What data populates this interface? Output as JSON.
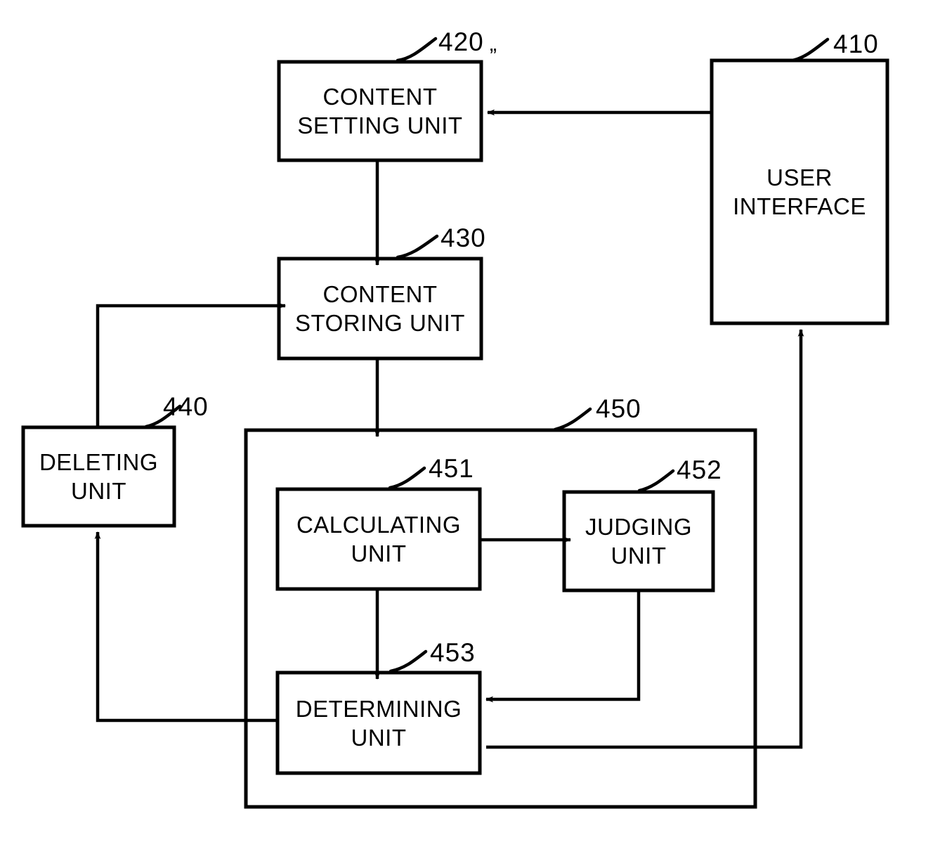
{
  "figure": {
    "type": "patent-block-diagram",
    "background_color": "#ffffff",
    "line_color": "#000000",
    "blocks": [
      {
        "id": "410",
        "label": "USER\nINTERFACE",
        "ref": "410"
      },
      {
        "id": "420",
        "label": "CONTENT\nSETTING UNIT",
        "ref": "420"
      },
      {
        "id": "430",
        "label": "CONTENT\nSTORING UNIT",
        "ref": "430"
      },
      {
        "id": "440",
        "label": "DELETING\nUNIT",
        "ref": "440"
      },
      {
        "id": "450",
        "label": "",
        "ref": "450"
      },
      {
        "id": "451",
        "label": "CALCULATING\nUNIT",
        "ref": "451"
      },
      {
        "id": "452",
        "label": "JUDGING\nUNIT",
        "ref": "452"
      },
      {
        "id": "453",
        "label": "DETERMINING\nUNIT",
        "ref": "453"
      }
    ],
    "stray_mark": "„"
  }
}
